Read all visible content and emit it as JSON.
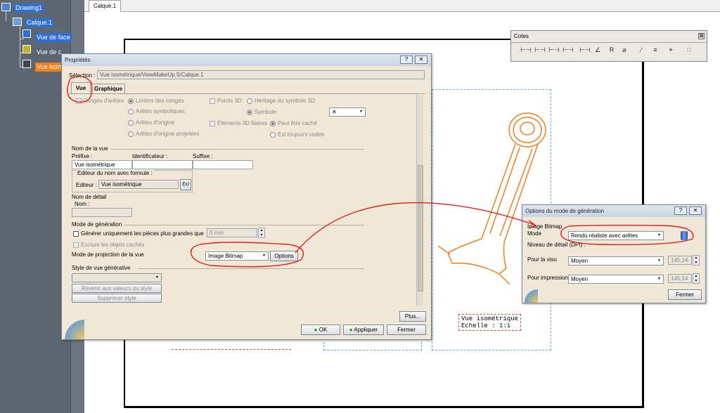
{
  "tree": {
    "root": "Drawing1",
    "calque": "Calque.1",
    "vue_face": "Vue de face",
    "vue_de": "Vue de c",
    "vue_iso": "Vue isom"
  },
  "tab_label": "Calque.1",
  "cotes": {
    "title": "Cotes",
    "close": "⊠",
    "icons": [
      "dim-icon",
      "dim-icon",
      "dim-icon",
      "dim-icon",
      "dim-icon",
      "angle-icon",
      "radius-icon",
      "dia-icon",
      "chamfer-icon",
      "thread-icon",
      "coord-icon",
      "table-icon"
    ]
  },
  "props": {
    "title": "Propriétés",
    "help": "?",
    "close": "✕",
    "selection_label": "Sélection :",
    "selection_value": "Vue isométrique/ViewMakeUp.5/Calque.1",
    "tab_vue": "Vue",
    "tab_graphique": "Graphique",
    "conges": "Congés d'arêtes",
    "limites": "Limites des congés",
    "aretes_symb": "Arêtes symboliques",
    "aretes_orig": "Arêtes d'origine",
    "aretes_orig_proj": "Arêtes d'origine projetées",
    "points3d": "Points 3D :",
    "heritage": "Héritage du symbole 3D",
    "symbole": "Symbole",
    "symbole_value": "✕",
    "elements3d": "Éléments 3D filaires",
    "peut_etre_cache": "Peut être caché",
    "est_toujours_visible": "Est toujours visible",
    "nom_vue": "Nom de la vue",
    "prefixe": "Préfixe :",
    "identificateur": "Identificateur :",
    "suffixe": "Suffixe :",
    "prefixe_value": "Vue isométrique",
    "editeur_group": "Editeur du nom avec formule :",
    "editeur_label": "Editeur :",
    "editeur_value": "Vue isométrique",
    "fx": "f(x)",
    "nom_detail": "Nom de détail",
    "nom": "Nom :",
    "mode_generation": "Mode de génération",
    "generer": "Générer uniquement les pièces plus grandes que",
    "generer_value": "0 mm",
    "exclure": "Exclure les objets cachés",
    "mode_projection": "Mode de projection de la vue",
    "mode_projection_value": "Image Bitmap",
    "options_btn": "Options",
    "style_vue": "Style de vue générative",
    "revenir": "Revenir aux valeurs du style",
    "supprimer": "Supprimer style",
    "plus_btn": "Plus...",
    "ok_btn": "OK",
    "appliquer_btn": "Appliquer",
    "fermer_btn": "Fermer"
  },
  "options": {
    "title": "Options du mode de génération",
    "help": "?",
    "close": "✕",
    "image_bitmap": "Image Bitmap",
    "mode": "Mode",
    "mode_value": "Rendu réaliste avec arêtes",
    "niveau": "Niveau de détail (DPI) :",
    "pour_visu": "Pour la visu",
    "visu_value": "Moyen",
    "visu_dpi": "145,14",
    "pour_impression": "Pour impression",
    "impression_value": "Moyen",
    "impression_dpi": "145,14",
    "fermer_btn": "Fermer"
  },
  "view_label": {
    "line1": "Vue isométrique",
    "line2": "Echelle :  1:1"
  },
  "colors": {
    "part": "#f07f1e",
    "annotation": "#e0201c"
  }
}
